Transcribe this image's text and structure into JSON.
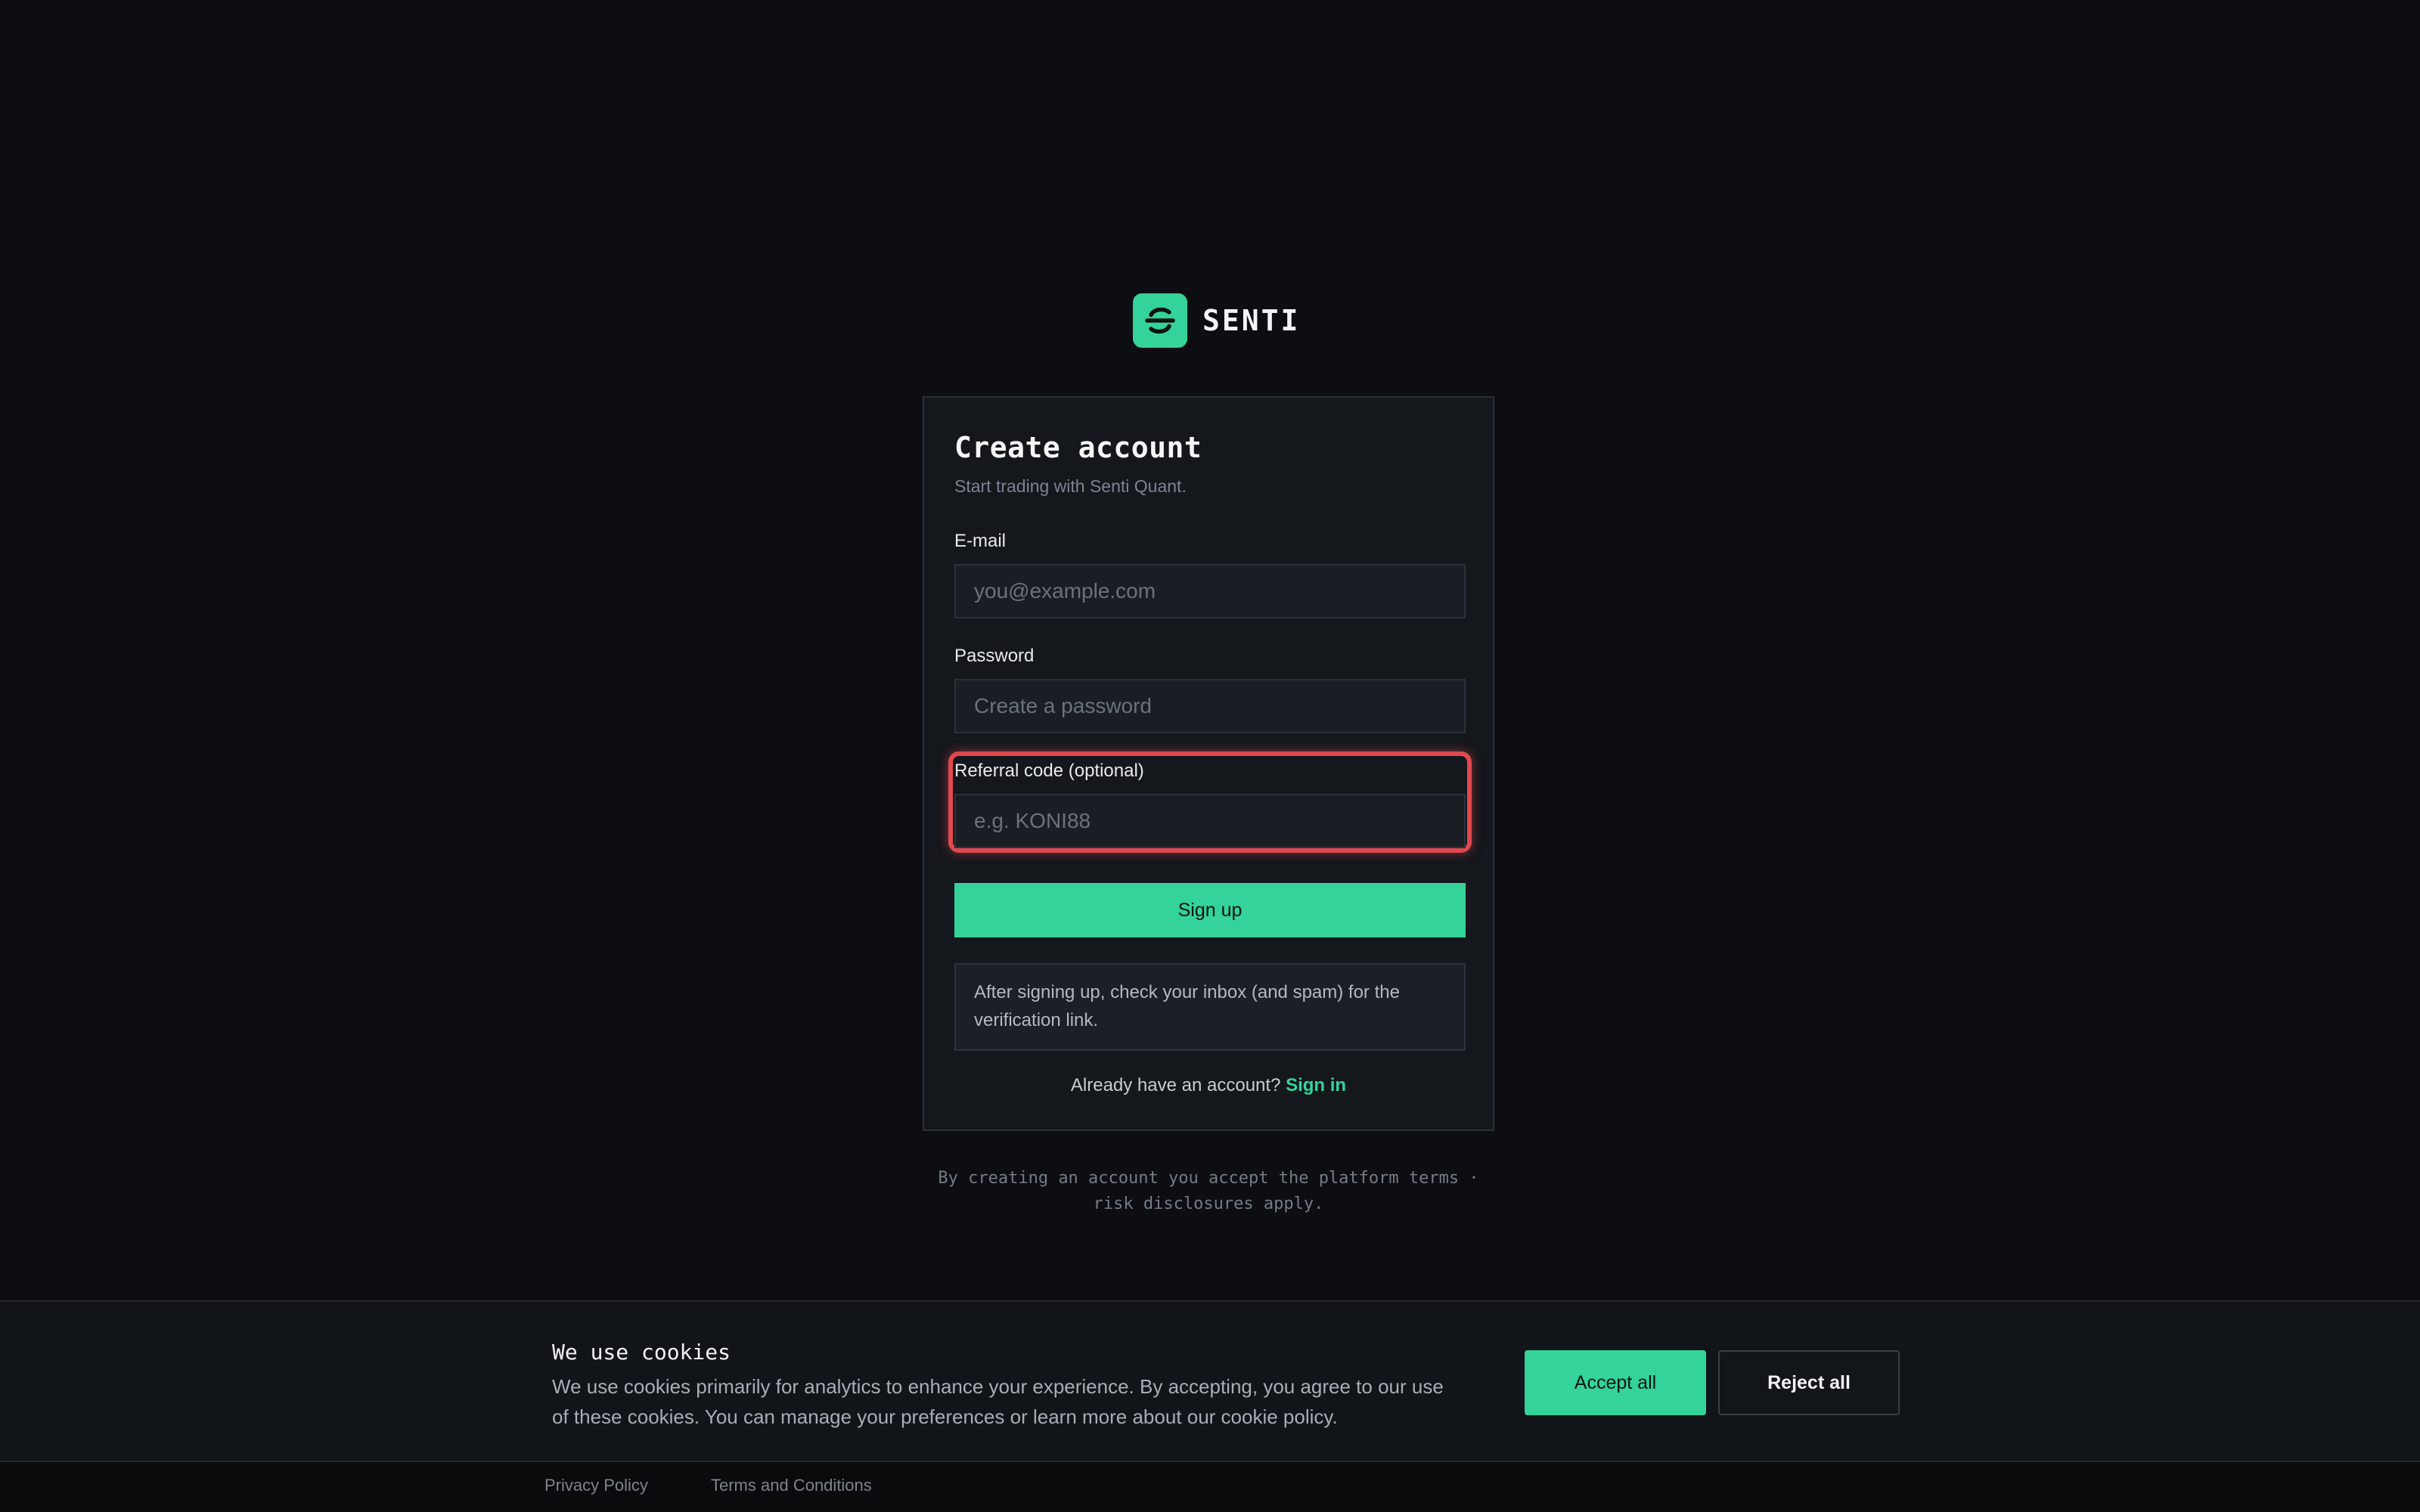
{
  "brand": {
    "name": "SENTI",
    "logo_icon": "senti-s-logo-icon",
    "accent_color": "#34d399"
  },
  "card": {
    "title": "Create account",
    "subtitle": "Start trading with Senti Quant."
  },
  "form": {
    "email": {
      "label": "E-mail",
      "placeholder": "you@example.com",
      "value": ""
    },
    "password": {
      "label": "Password",
      "placeholder": "Create a password",
      "value": ""
    },
    "referral": {
      "label": "Referral code (optional)",
      "placeholder": "e.g. KONI88",
      "value": "",
      "highlight_color": "#e0484e"
    },
    "submit_label": "Sign up"
  },
  "notice": "After signing up, check your inbox (and spam) for the verification link.",
  "signin": {
    "prompt": "Already have an account?",
    "link_label": "Sign in"
  },
  "terms": {
    "line1": "By creating an account you accept the platform terms ·",
    "line2": "risk disclosures apply."
  },
  "cookie_banner": {
    "title": "We use cookies",
    "body": "We use cookies primarily for analytics to enhance your experience. By accepting, you agree to our use of these cookies. You can manage your preferences or learn more about our cookie policy.",
    "accept_label": "Accept all",
    "reject_label": "Reject all"
  },
  "footer": {
    "links": [
      "Privacy Policy",
      "Terms and Conditions"
    ]
  }
}
